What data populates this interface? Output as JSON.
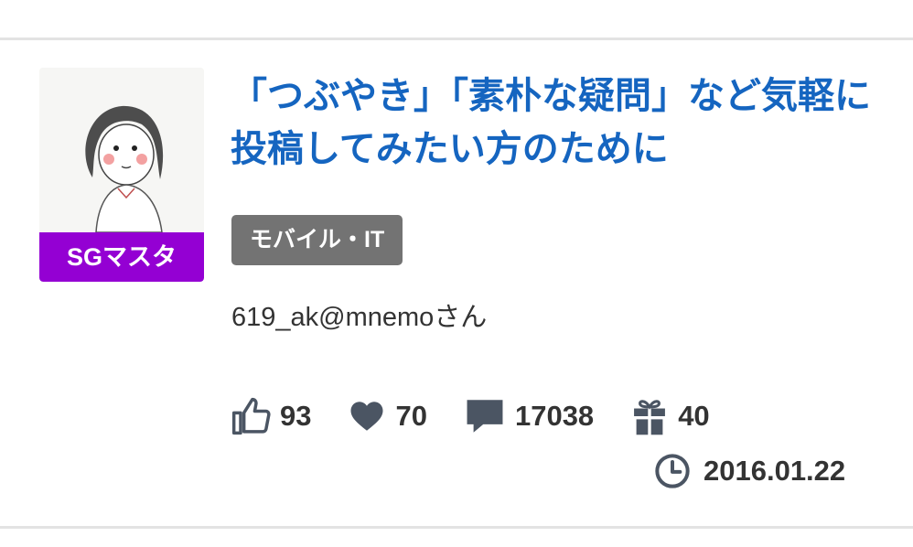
{
  "post": {
    "title": "「つぶやき」「素朴な疑問」など気軽に投稿してみたい方のために",
    "category": "モバイル・IT",
    "author": "619_ak@mnemoさん",
    "date": "2016.01.22"
  },
  "user": {
    "rank_label": "SGマスタ",
    "rank_color": "#9400d3"
  },
  "stats": {
    "likes": "93",
    "favorites": "70",
    "comments": "17038",
    "gifts": "40"
  },
  "icons": {
    "likes": "thumbs-up-icon",
    "favorites": "heart-icon",
    "comments": "speech-bubble-icon",
    "gifts": "gift-icon",
    "date": "clock-icon"
  },
  "colors": {
    "title": "#1565c0",
    "category_bg": "#737373",
    "icon": "#4b5563"
  }
}
